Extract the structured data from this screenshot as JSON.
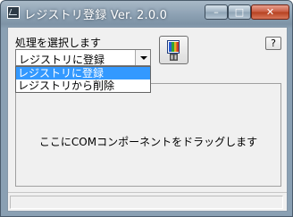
{
  "window": {
    "title": "レジストリ登録 Ver. 2.0.0",
    "buttons": {
      "minimize": "–",
      "maximize": "□",
      "close": "✕"
    }
  },
  "form": {
    "prompt": "処理を選択します",
    "combo": {
      "selected": "レジストリに登録",
      "options": [
        "レジストリに登録",
        "レジストリから削除"
      ]
    },
    "help_label": "?"
  },
  "drop_area": {
    "text": "ここにCOMコンポーネントをドラッグします"
  },
  "status_bar": {
    "text": ""
  }
}
